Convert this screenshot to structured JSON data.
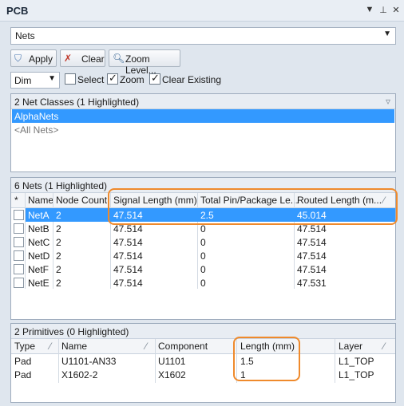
{
  "titlebar": {
    "title": "PCB"
  },
  "top_dropdown": {
    "value": "Nets"
  },
  "toolbar": {
    "apply_label": "Apply",
    "clear_label": "Clear",
    "zoom_label": "Zoom Level..."
  },
  "options": {
    "dim_value": "Dim",
    "select_label": "Select",
    "select_checked": false,
    "zoom_label": "Zoom",
    "zoom_checked": true,
    "clear_existing_label": "Clear Existing",
    "clear_existing_checked": true
  },
  "net_classes": {
    "header": "2 Net Classes (1 Highlighted)",
    "items": [
      {
        "label": "AlphaNets",
        "highlighted": true
      },
      {
        "label": "<All Nets>",
        "highlighted": false
      }
    ]
  },
  "nets": {
    "header": "6 Nets (1 Highlighted)",
    "columns": [
      "*",
      "Name",
      "Node Count",
      "Signal Length (mm)",
      "Total Pin/Package Le...",
      "Routed Length (m..."
    ],
    "rows": [
      {
        "name": "NetA",
        "node_count": "2",
        "signal_length": "47.514",
        "pin_pkg_length": "2.5",
        "routed_length": "45.014",
        "highlighted": true
      },
      {
        "name": "NetB",
        "node_count": "2",
        "signal_length": "47.514",
        "pin_pkg_length": "0",
        "routed_length": "47.514",
        "highlighted": false
      },
      {
        "name": "NetC",
        "node_count": "2",
        "signal_length": "47.514",
        "pin_pkg_length": "0",
        "routed_length": "47.514",
        "highlighted": false
      },
      {
        "name": "NetD",
        "node_count": "2",
        "signal_length": "47.514",
        "pin_pkg_length": "0",
        "routed_length": "47.514",
        "highlighted": false
      },
      {
        "name": "NetF",
        "node_count": "2",
        "signal_length": "47.514",
        "pin_pkg_length": "0",
        "routed_length": "47.514",
        "highlighted": false
      },
      {
        "name": "NetE",
        "node_count": "2",
        "signal_length": "47.514",
        "pin_pkg_length": "0",
        "routed_length": "47.531",
        "highlighted": false
      }
    ]
  },
  "primitives": {
    "header": "2 Primitives (0 Highlighted)",
    "columns": [
      "Type",
      "Name",
      "Component",
      "Length (mm)",
      "Layer"
    ],
    "rows": [
      {
        "type": "Pad",
        "name": "U1101-AN33",
        "component": "U1101",
        "length": "1.5",
        "layer": "L1_TOP"
      },
      {
        "type": "Pad",
        "name": "X1602-2",
        "component": "X1602",
        "length": "1",
        "layer": "L1_TOP"
      }
    ]
  },
  "colors": {
    "highlight": "#3399ff",
    "callout": "#ef8a2c"
  },
  "icons": {
    "pin": "pin-icon",
    "close": "close-icon",
    "menu": "menu-icon"
  }
}
